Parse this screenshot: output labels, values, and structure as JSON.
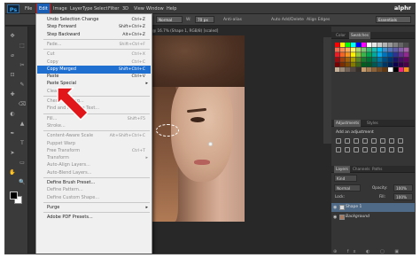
{
  "app": {
    "logo": "Ps"
  },
  "menubar": [
    "File",
    "Edit",
    "Image",
    "Layer",
    "Type",
    "Select",
    "Filter",
    "3D",
    "View",
    "Window",
    "Help"
  ],
  "options": {
    "mode_value": "Normal",
    "width_label": "W:",
    "width_value": "70 px",
    "anti_alias": "Anti-alias",
    "auto_add": "Auto Add/Delete",
    "align_edges": "Align Edges",
    "workspace": "Essentials"
  },
  "edit_menu": {
    "items": [
      {
        "label": "Undo Selection Change",
        "shortcut": "Ctrl+Z",
        "enabled": true
      },
      {
        "label": "Step Forward",
        "shortcut": "Shift+Ctrl+Z",
        "enabled": true
      },
      {
        "label": "Step Backward",
        "shortcut": "Alt+Ctrl+Z",
        "enabled": true
      },
      {
        "sep": true
      },
      {
        "label": "Fade...",
        "shortcut": "Shift+Ctrl+F",
        "enabled": false
      },
      {
        "sep": true
      },
      {
        "label": "Cut",
        "shortcut": "Ctrl+X",
        "enabled": false
      },
      {
        "label": "Copy",
        "shortcut": "Ctrl+C",
        "enabled": false
      },
      {
        "label": "Copy Merged",
        "shortcut": "Shift+Ctrl+C",
        "enabled": true,
        "highlighted": true
      },
      {
        "label": "Paste",
        "shortcut": "Ctrl+V",
        "enabled": true
      },
      {
        "label": "Paste Special",
        "shortcut": "",
        "enabled": true,
        "submenu": true
      },
      {
        "label": "Clear",
        "shortcut": "",
        "enabled": false
      },
      {
        "sep": true
      },
      {
        "label": "Check Spelling...",
        "shortcut": "",
        "enabled": false
      },
      {
        "label": "Find and Replace Text...",
        "shortcut": "",
        "enabled": false
      },
      {
        "sep": true
      },
      {
        "label": "Fill...",
        "shortcut": "Shift+F5",
        "enabled": false
      },
      {
        "label": "Stroke...",
        "shortcut": "",
        "enabled": false
      },
      {
        "sep": true
      },
      {
        "label": "Content-Aware Scale",
        "shortcut": "Alt+Shift+Ctrl+C",
        "enabled": false
      },
      {
        "label": "Puppet Warp",
        "shortcut": "",
        "enabled": false
      },
      {
        "label": "Free Transform",
        "shortcut": "Ctrl+T",
        "enabled": false
      },
      {
        "label": "Transform",
        "shortcut": "",
        "enabled": false,
        "submenu": true
      },
      {
        "label": "Auto-Align Layers...",
        "shortcut": "",
        "enabled": false
      },
      {
        "label": "Auto-Blend Layers...",
        "shortcut": "",
        "enabled": false
      },
      {
        "sep": true
      },
      {
        "label": "Define Brush Preset...",
        "shortcut": "",
        "enabled": true
      },
      {
        "label": "Define Pattern...",
        "shortcut": "",
        "enabled": false
      },
      {
        "label": "Define Custom Shape...",
        "shortcut": "",
        "enabled": false
      },
      {
        "sep": true
      },
      {
        "label": "Purge",
        "shortcut": "",
        "enabled": true,
        "submenu": true
      },
      {
        "sep": true
      },
      {
        "label": "Adobe PDF Presets...",
        "shortcut": "",
        "enabled": true
      }
    ]
  },
  "document_tab": "@ 16.7% (Shape 1, RGB/8) [scaled]",
  "panels": {
    "color_tabs": [
      "Color",
      "Swatches"
    ],
    "adjust_tabs": [
      "Adjustments",
      "Styles"
    ],
    "adjust_title": "Add an adjustment",
    "layers_tabs": [
      "Layers",
      "Channels",
      "Paths"
    ],
    "kind_label": "Kind",
    "blend_mode": "Normal",
    "opacity_label": "Opacity:",
    "opacity_value": "100%",
    "lock_label": "Lock:",
    "fill_label": "Fill:",
    "fill_value": "100%",
    "layers": [
      {
        "name": "Shape 1",
        "selected": true
      },
      {
        "name": "Background",
        "selected": false
      }
    ]
  },
  "watermark": "alphr",
  "colors": {
    "highlight": "#1f6fd1",
    "edit_outline": "#e1161b",
    "arrow": "#e1161b"
  }
}
